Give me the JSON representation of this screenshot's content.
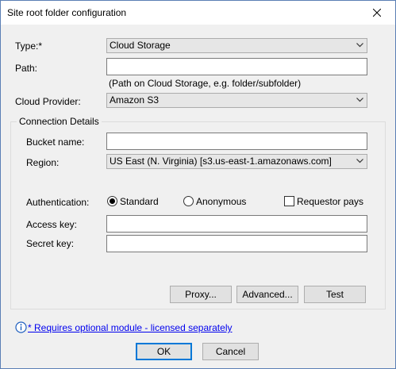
{
  "window": {
    "title": "Site root folder configuration"
  },
  "form": {
    "type_label": "Type:*",
    "type_value": "Cloud Storage",
    "path_label": "Path:",
    "path_value": "",
    "path_hint": "(Path on Cloud Storage, e.g. folder/subfolder)",
    "provider_label": "Cloud Provider:",
    "provider_value": "Amazon S3"
  },
  "connection": {
    "group_label": "Connection Details",
    "bucket_label": "Bucket name:",
    "bucket_value": "",
    "region_label": "Region:",
    "region_value": "US East (N. Virginia) [s3.us-east-1.amazonaws.com]",
    "auth_label": "Authentication:",
    "auth_options": [
      "Standard",
      "Anonymous"
    ],
    "auth_selected": "Standard",
    "requestor_pays_label": "Requestor pays",
    "requestor_pays_checked": false,
    "access_key_label": "Access key:",
    "access_key_value": "",
    "secret_key_label": "Secret key:",
    "secret_key_value": "",
    "buttons": {
      "proxy": "Proxy...",
      "advanced": "Advanced...",
      "test": "Test"
    }
  },
  "footer": {
    "module_note": "* Requires optional module - licensed separately",
    "ok": "OK",
    "cancel": "Cancel"
  },
  "icons": {
    "close": "close-icon",
    "dropdown": "chevron-down-icon",
    "info": "info-icon"
  },
  "colors": {
    "link": "#0000ee",
    "default_button_border": "#0078d7",
    "info_icon": "#1f5fbf"
  }
}
